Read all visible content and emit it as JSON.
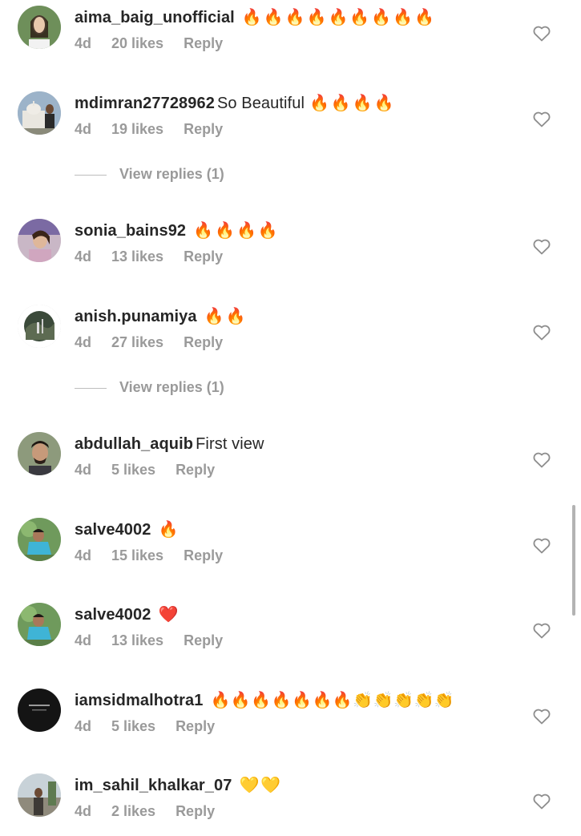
{
  "comments": [
    {
      "username": "aima_baig_unofficial",
      "text": "",
      "emojis": "🔥🔥🔥🔥🔥🔥🔥🔥🔥",
      "time": "4d",
      "likes": "20 likes",
      "reply": "Reply",
      "avatar_color": "#6e8f5a"
    },
    {
      "username": "mdimran27728962",
      "text": "So Beautiful",
      "emojis": "🔥🔥🔥🔥",
      "time": "4d",
      "likes": "19 likes",
      "reply": "Reply",
      "avatar_color": "#8aa0b5"
    },
    {
      "username": "sonia_bains92",
      "text": "",
      "emojis": "🔥🔥🔥🔥",
      "time": "4d",
      "likes": "13 likes",
      "reply": "Reply",
      "avatar_color": "#b08aa8"
    },
    {
      "username": "anish.punamiya",
      "text": "",
      "emojis": "🔥🔥",
      "time": "4d",
      "likes": "27 likes",
      "reply": "Reply",
      "avatar_color": "#3b4a3a"
    },
    {
      "username": "abdullah_aquib",
      "text": "First view",
      "emojis": "",
      "time": "4d",
      "likes": "5 likes",
      "reply": "Reply",
      "avatar_color": "#7a8a6a"
    },
    {
      "username": "salve4002",
      "text": "",
      "emojis": "🔥",
      "time": "4d",
      "likes": "15 likes",
      "reply": "Reply",
      "avatar_color": "#6f9a5c"
    },
    {
      "username": "salve4002",
      "text": "",
      "emojis": "❤️",
      "time": "4d",
      "likes": "13 likes",
      "reply": "Reply",
      "avatar_color": "#6f9a5c"
    },
    {
      "username": "iamsidmalhotra1",
      "text": "",
      "emojis": "🔥🔥🔥🔥🔥🔥🔥👏👏👏👏👏",
      "time": "4d",
      "likes": "5 likes",
      "reply": "Reply",
      "avatar_color": "#141414"
    },
    {
      "username": "im_sahil_khalkar_07",
      "text": "",
      "emojis": "💛💛",
      "time": "4d",
      "likes": "2 likes",
      "reply": "Reply",
      "avatar_color": "#9aa3a8"
    }
  ],
  "view_replies": [
    "View replies (1)",
    "View replies (1)"
  ]
}
